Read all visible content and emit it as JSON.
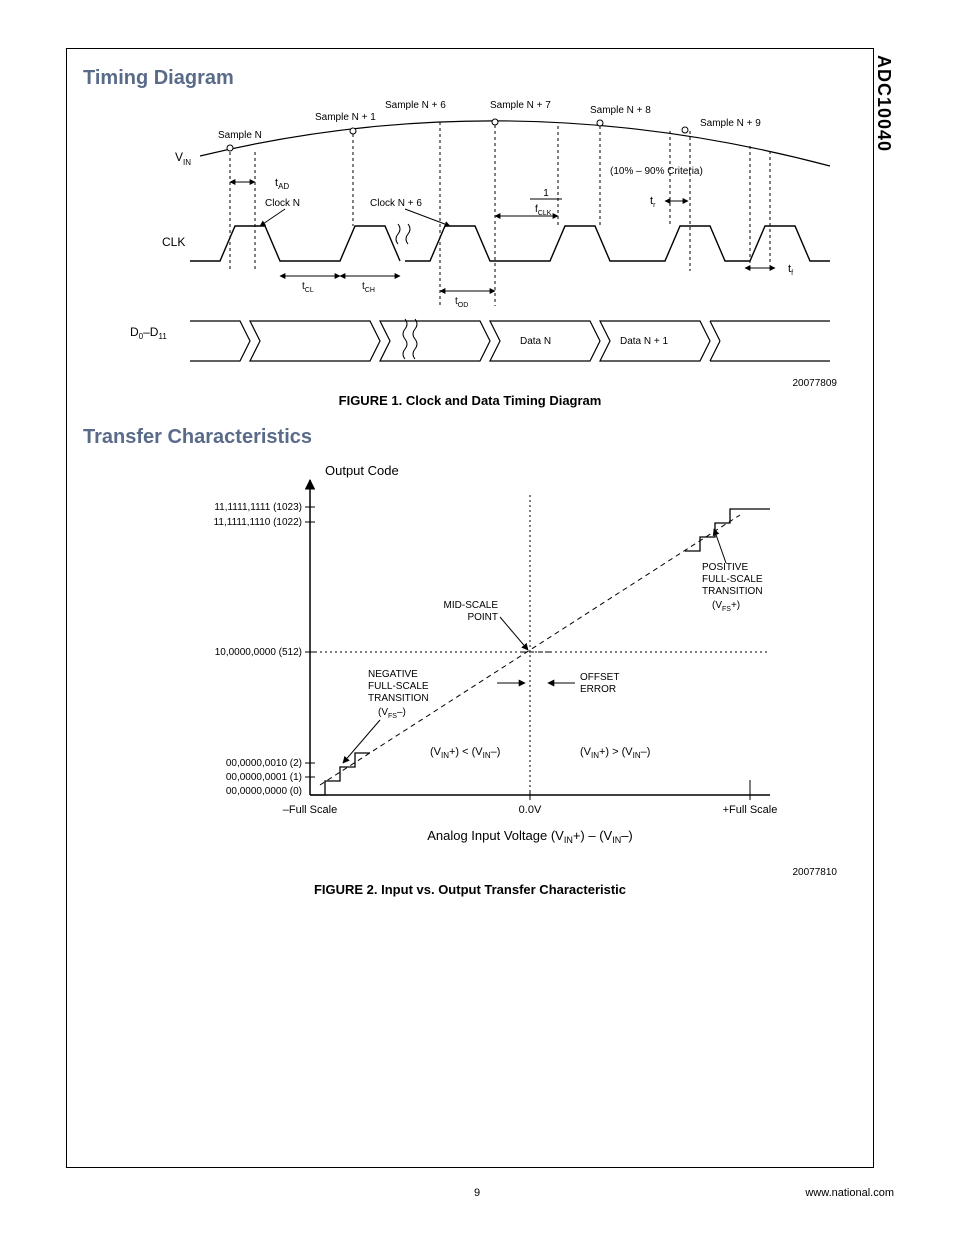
{
  "sidelabel": "ADC10040",
  "page_number": "9",
  "footer_url": "www.national.com",
  "section1": {
    "title": "Timing Diagram"
  },
  "section2": {
    "title": "Transfer Characteristics"
  },
  "fig1": {
    "caption": "FIGURE 1. Clock and Data Timing Diagram",
    "id": "20077809",
    "labels": {
      "vin": "V",
      "vin_sub": "IN",
      "clk": "CLK",
      "dbus": "D",
      "dbus_sub0": "0",
      "dbus_dash": "–D",
      "dbus_sub1": "11",
      "sample_n": "Sample N",
      "sample_n1": "Sample N + 1",
      "sample_n6": "Sample N + 6",
      "sample_n7": "Sample N + 7",
      "sample_n8": "Sample N + 8",
      "sample_n9": "Sample N + 9",
      "clock_n": "Clock N",
      "clock_n6": "Clock N + 6",
      "tAD": "t",
      "tAD_sub": "AD",
      "criteria": "(10% – 90% Criteria)",
      "one_over": "1",
      "fclk": "f",
      "fclk_sub": "CLK",
      "tr": "t",
      "tr_sub": "r",
      "tf": "t",
      "tf_sub": "f",
      "tCL": "t",
      "tCL_sub": "CL",
      "tCH": "t",
      "tCH_sub": "CH",
      "tOD": "t",
      "tOD_sub": "OD",
      "data_n": "Data N",
      "data_n1": "Data N + 1"
    }
  },
  "fig2": {
    "caption": "FIGURE 2. Input vs. Output Transfer Characteristic",
    "id": "20077810",
    "labels": {
      "output_code": "Output Code",
      "code1023": "11,1111,1111 (1023)",
      "code1022": "11,1111,1110 (1022)",
      "code512": "10,0000,0000 (512)",
      "code2": "00,0000,0010 (2)",
      "code1": "00,0000,0001 (1)",
      "code0": "00,0000,0000 (0)",
      "mid_scale": "MID-SCALE",
      "mid_scale_2": "POINT",
      "neg_fs_1": "NEGATIVE",
      "neg_fs_2": "FULL-SCALE",
      "neg_fs_3": "TRANSITION",
      "neg_fs_4": "(V",
      "neg_fs_4sub": "FS",
      "neg_fs_4end": "–)",
      "pos_fs_1": "POSITIVE",
      "pos_fs_2": "FULL-SCALE",
      "pos_fs_3": "TRANSITION",
      "pos_fs_4": "(V",
      "pos_fs_4sub": "FS",
      "pos_fs_4end": "+)",
      "offset_err": "OFFSET",
      "offset_err2": "ERROR",
      "vin_lt_1": "(V",
      "vin_lt_1sub": "IN",
      "vin_lt_1p": "+) < (V",
      "vin_lt_2sub": "IN",
      "vin_lt_2p": "–)",
      "vin_gt_1": "(V",
      "vin_gt_1sub": "IN",
      "vin_gt_1p": "+) > (V",
      "vin_gt_2sub": "IN",
      "vin_gt_2p": "–)",
      "neg_full": "–Full Scale",
      "zero_v": "0.0V",
      "pos_full": "+Full Scale",
      "xaxis": "Analog Input Voltage (V",
      "xaxis_sub": "IN",
      "xaxis_mid": "+) – (V",
      "xaxis_sub2": "IN",
      "xaxis_end": "–)"
    }
  }
}
